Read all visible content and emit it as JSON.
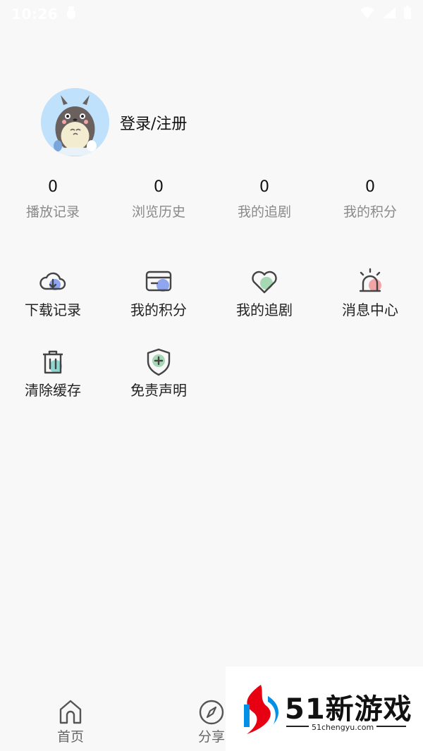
{
  "status_bar": {
    "time": "10:26"
  },
  "profile": {
    "login_label": "登录/注册"
  },
  "stats": [
    {
      "value": "0",
      "label": "播放记录"
    },
    {
      "value": "0",
      "label": "浏览历史"
    },
    {
      "value": "0",
      "label": "我的追剧"
    },
    {
      "value": "0",
      "label": "我的积分"
    }
  ],
  "menu": [
    {
      "label": "下载记录",
      "icon": "cloud-download-icon",
      "accent": "#8fa6ee"
    },
    {
      "label": "我的积分",
      "icon": "card-icon",
      "accent": "#8fa6ee"
    },
    {
      "label": "我的追剧",
      "icon": "heart-icon",
      "accent": "#a6d8b4"
    },
    {
      "label": "消息中心",
      "icon": "alarm-icon",
      "accent": "#f2a4a6"
    },
    {
      "label": "清除缓存",
      "icon": "trash-icon",
      "accent": "#8fd6d0"
    },
    {
      "label": "免责声明",
      "icon": "shield-plus-icon",
      "accent": "#a6d8b4"
    }
  ],
  "tabbar": {
    "home_label": "首页",
    "share_label": "分享"
  },
  "watermark": {
    "title": "51新游戏",
    "url": "51chengyu.com"
  }
}
